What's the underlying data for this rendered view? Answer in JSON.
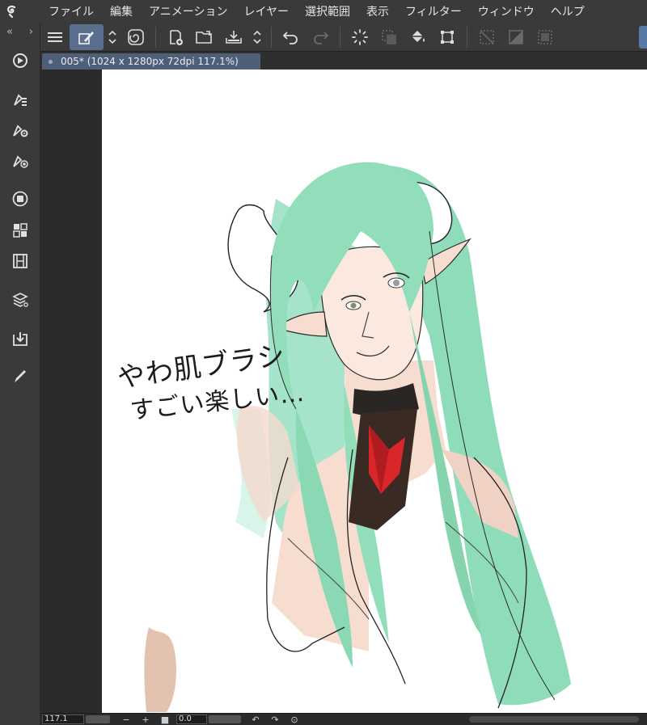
{
  "app": {
    "logo": "clip-studio-logo"
  },
  "menu": {
    "items": [
      "ファイル",
      "編集",
      "アニメーション",
      "レイヤー",
      "選択範囲",
      "表示",
      "フィルター",
      "ウィンドウ",
      "ヘルプ"
    ]
  },
  "document": {
    "tab_title": "005* (1024 x 1280px 72dpi 117.1%)"
  },
  "canvas": {
    "handwriting_line1": "やわ肌ブラシ",
    "handwriting_line2": "すごい楽しい…"
  },
  "status": {
    "zoom": "117.1",
    "angle": "0.0",
    "zoom_out": "−",
    "zoom_in": "+"
  },
  "colors": {
    "hair": "#8fdcbb",
    "skin": "#f6ddd0",
    "gem": "#d8262a",
    "accent": "#5a6e8e"
  }
}
